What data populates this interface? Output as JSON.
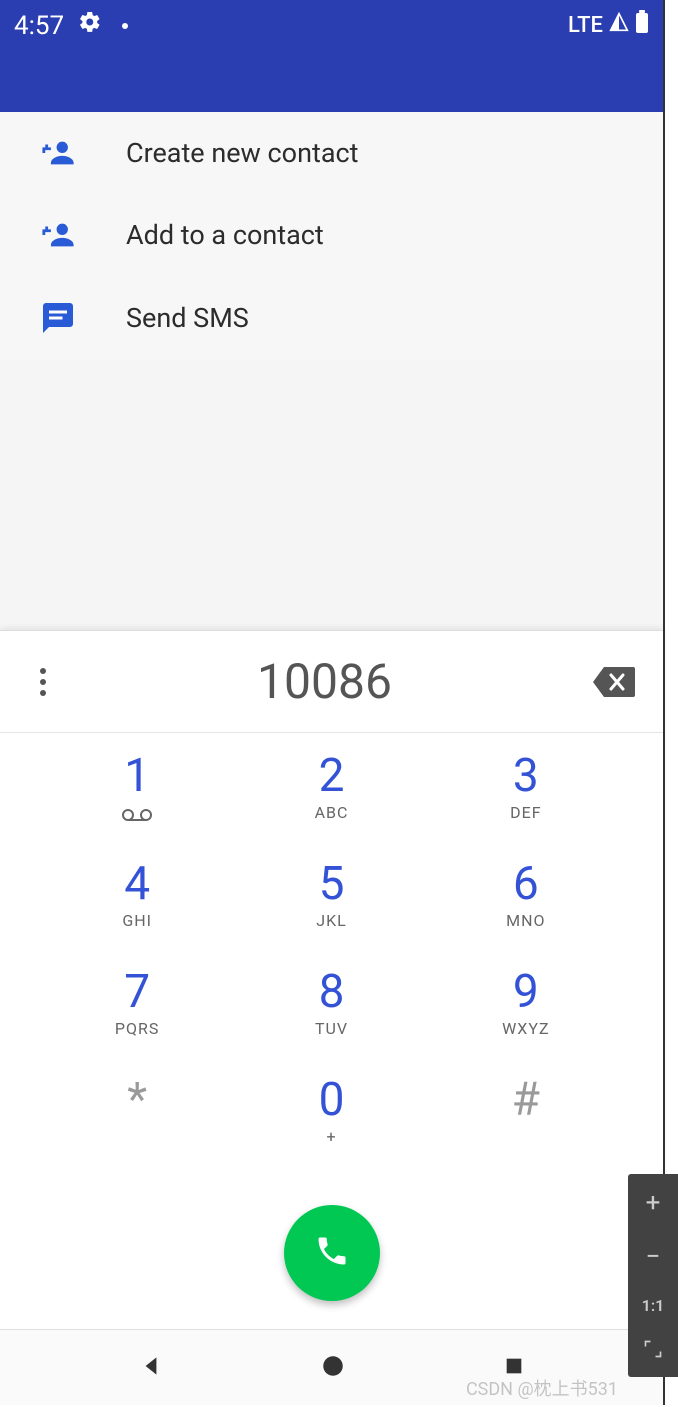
{
  "status_bar": {
    "time": "4:57",
    "network_label": "LTE"
  },
  "actions": [
    {
      "label": "Create new contact",
      "icon": "person-add"
    },
    {
      "label": "Add to a contact",
      "icon": "person-add"
    },
    {
      "label": "Send SMS",
      "icon": "sms"
    }
  ],
  "dialer": {
    "entered_number": "10086",
    "keys": [
      {
        "digit": "1",
        "sub": "voicemail"
      },
      {
        "digit": "2",
        "sub": "ABC"
      },
      {
        "digit": "3",
        "sub": "DEF"
      },
      {
        "digit": "4",
        "sub": "GHI"
      },
      {
        "digit": "5",
        "sub": "JKL"
      },
      {
        "digit": "6",
        "sub": "MNO"
      },
      {
        "digit": "7",
        "sub": "PQRS"
      },
      {
        "digit": "8",
        "sub": "TUV"
      },
      {
        "digit": "9",
        "sub": "WXYZ"
      },
      {
        "digit": "*",
        "sub": "",
        "muted": true
      },
      {
        "digit": "0",
        "sub": "+"
      },
      {
        "digit": "#",
        "sub": "",
        "muted": true
      }
    ]
  },
  "emulator_toolbar": {
    "ratio_label": "1:1"
  },
  "watermark": "CSDN @枕上书531"
}
